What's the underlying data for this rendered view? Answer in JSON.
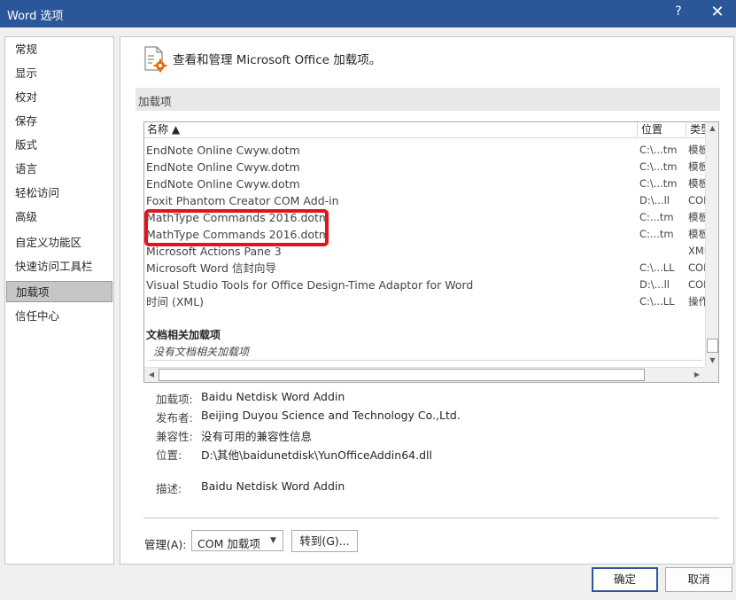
{
  "window": {
    "title": "Word 选项",
    "help": "?",
    "close": "✕"
  },
  "nav": {
    "items": [
      {
        "label": "常规"
      },
      {
        "label": "显示"
      },
      {
        "label": "校对"
      },
      {
        "label": "保存"
      },
      {
        "label": "版式"
      },
      {
        "label": "语言"
      },
      {
        "label": "轻松访问"
      },
      {
        "label": "高级"
      },
      {
        "label": "自定义功能区"
      },
      {
        "label": "快速访问工具栏"
      },
      {
        "label": "加载项"
      },
      {
        "label": "信任中心"
      }
    ],
    "selected": "加载项"
  },
  "header": {
    "text": "查看和管理 Microsoft Office 加载项。"
  },
  "section": {
    "title": "加载项"
  },
  "list": {
    "columns": {
      "name": "名称 ▲",
      "location": "位置",
      "type": "类型"
    },
    "rows": [
      {
        "name": "EndNote Online Cwyw.dotm",
        "location": "C:\\...tm",
        "type": "模板"
      },
      {
        "name": "EndNote Online Cwyw.dotm",
        "location": "C:\\...tm",
        "type": "模板"
      },
      {
        "name": "EndNote Online Cwyw.dotm",
        "location": "C:\\...tm",
        "type": "模板"
      },
      {
        "name": "Foxit Phantom Creator COM Add-in",
        "location": "D:\\...ll",
        "type": "COM"
      },
      {
        "name": "MathType Commands 2016.dotm",
        "location": "C:...tm",
        "type": "模板"
      },
      {
        "name": "MathType Commands 2016.dotm",
        "location": "C:...tm",
        "type": "模板"
      },
      {
        "name": "Microsoft Actions Pane 3",
        "location": "",
        "type": "XML"
      },
      {
        "name": "Microsoft Word 信封向导",
        "location": "C:\\...LL",
        "type": "COM"
      },
      {
        "name": "Visual Studio Tools for Office Design-Time Adaptor for Word",
        "location": "D:\\...ll",
        "type": "COM"
      },
      {
        "name": "时间 (XML)",
        "location": "C:\\...LL",
        "type": "操作"
      }
    ],
    "group_title": "文档相关加载项",
    "group_empty": "没有文档相关加载项"
  },
  "details": {
    "addin_label": "加载项:",
    "addin_value": "Baidu Netdisk Word Addin",
    "publisher_label": "发布者:",
    "publisher_value": "Beijing Duyou Science and Technology Co.,Ltd.",
    "compat_label": "兼容性:",
    "compat_value": "没有可用的兼容性信息",
    "location_label": "位置:",
    "location_value": "D:\\其他\\baidunetdisk\\YunOfficeAddin64.dll",
    "desc_label": "描述:",
    "desc_value": "Baidu Netdisk Word Addin"
  },
  "manage": {
    "label": "管理(A):",
    "selected": "COM 加载项",
    "goto": "转到(G)..."
  },
  "buttons": {
    "ok": "确定",
    "cancel": "取消"
  },
  "colors": {
    "titlebar": "#2b579a",
    "highlight": "#e3121b"
  }
}
